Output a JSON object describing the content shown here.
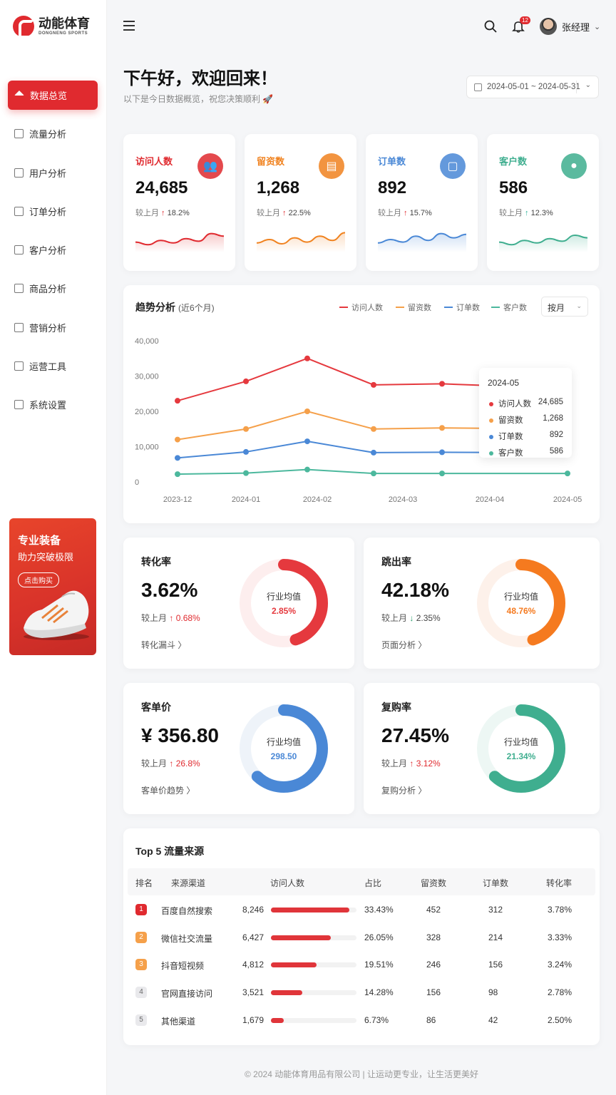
{
  "brand": {
    "name_cn": "动能体育",
    "name_en": "DONGNENG SPORTS"
  },
  "sidebar": {
    "items": [
      {
        "label": "数据总览",
        "active": true
      },
      {
        "label": "流量分析"
      },
      {
        "label": "用户分析"
      },
      {
        "label": "订单分析"
      },
      {
        "label": "客户分析"
      },
      {
        "label": "商品分析"
      },
      {
        "label": "营销分析"
      },
      {
        "label": "运营工具"
      },
      {
        "label": "系统设置"
      }
    ],
    "promo": {
      "title": "专业装备",
      "subtitle": "助力突破极限",
      "button": "点击购买"
    }
  },
  "header": {
    "notifications": "12",
    "user": "张经理"
  },
  "welcome": {
    "title": "下午好，欢迎回来！",
    "subtitle": "以下是今日数据概览，祝您决策顺利 🚀"
  },
  "date_range": "2024-05-01 ~ 2024-05-31",
  "colors": {
    "accent": "#e02a2f",
    "visitors": "#e5393e",
    "leads": "#f5a04a",
    "orders": "#4a88d6",
    "customers": "#4cb89d"
  },
  "stats": [
    {
      "label": "访问人数",
      "value": "24,685",
      "cmp_label": "较上月",
      "cmp": "18.2%",
      "color": "#e02a2f",
      "icon": "users-icon",
      "trend": [
        0.35,
        0.2,
        0.45,
        0.3,
        0.55,
        0.4,
        0.85,
        0.7
      ]
    },
    {
      "label": "留资数",
      "value": "1,268",
      "cmp_label": "较上月",
      "cmp": "22.5%",
      "color": "#f0821f",
      "icon": "document-icon",
      "trend": [
        0.3,
        0.5,
        0.25,
        0.6,
        0.35,
        0.7,
        0.45,
        0.9
      ]
    },
    {
      "label": "订单数",
      "value": "892",
      "cmp_label": "较上月",
      "cmp": "15.7%",
      "color": "#4a88d6",
      "icon": "clipboard-icon",
      "trend": [
        0.3,
        0.5,
        0.35,
        0.7,
        0.45,
        0.85,
        0.6,
        0.8
      ]
    },
    {
      "label": "客户数",
      "value": "586",
      "cmp_label": "较上月",
      "cmp": "12.3%",
      "color": "#3fae8f",
      "icon": "user-icon",
      "trend": [
        0.35,
        0.2,
        0.45,
        0.3,
        0.55,
        0.4,
        0.75,
        0.6
      ]
    }
  ],
  "trend": {
    "title": "趋势分析",
    "subtitle": "(近6个月)",
    "period": "按月",
    "tooltip_title": "2024-05"
  },
  "chart_data": {
    "type": "line",
    "x": [
      "2023-12",
      "2024-01",
      "2024-02",
      "2024-03",
      "2024-04",
      "2024-05"
    ],
    "ylim": [
      0,
      40000
    ],
    "yticks": [
      "40,000",
      "30,000",
      "20,000",
      "10,000",
      "0"
    ],
    "series": [
      {
        "name": "访问人数",
        "color": "#e5393e",
        "values": [
          23000,
          28500,
          35000,
          27500,
          27800,
          24685
        ]
      },
      {
        "name": "留资数",
        "color": "#f5a04a",
        "values": [
          12000,
          15000,
          20000,
          15000,
          15300,
          1268
        ]
      },
      {
        "name": "订单数",
        "color": "#4a88d6",
        "values": [
          6800,
          8500,
          11500,
          8300,
          8400,
          892
        ]
      },
      {
        "name": "客户数",
        "color": "#4cb89d",
        "values": [
          2200,
          2500,
          3500,
          2400,
          2400,
          586
        ]
      }
    ],
    "tooltip_values": [
      "24,685",
      "1,268",
      "892",
      "586"
    ],
    "legend": "top-right",
    "grid": false
  },
  "metrics": [
    {
      "label": "转化率",
      "value": "3.62%",
      "cmp_label": "较上月",
      "cmp": "0.68%",
      "direction": "up",
      "link": "转化漏斗 〉",
      "avg_label": "行业均值",
      "avg_value": "2.85%",
      "progress": 0.45,
      "color": "#e5393e",
      "track": "#fdeeee"
    },
    {
      "label": "跳出率",
      "value": "42.18%",
      "cmp_label": "较上月",
      "cmp": "2.35%",
      "direction": "down",
      "link": "页面分析 〉",
      "avg_label": "行业均值",
      "avg_value": "48.76%",
      "progress": 0.45,
      "color": "#f57a1f",
      "track": "#fdf1ea"
    },
    {
      "label": "客单价",
      "value": "¥ 356.80",
      "cmp_label": "较上月",
      "cmp": "26.8%",
      "direction": "up",
      "link": "客单价趋势 〉",
      "avg_label": "行业均值",
      "avg_value": "298.50",
      "progress": 0.62,
      "color": "#4a88d6",
      "track": "#eef3f9"
    },
    {
      "label": "复购率",
      "value": "27.45%",
      "cmp_label": "较上月",
      "cmp": "3.12%",
      "direction": "up",
      "link": "复购分析 〉",
      "avg_label": "行业均值",
      "avg_value": "21.34%",
      "progress": 0.62,
      "color": "#3fae8f",
      "track": "#edf7f4"
    }
  ],
  "sources": {
    "title": "Top 5 流量来源",
    "headers": [
      "排名",
      "来源渠道",
      "访问人数",
      "占比",
      "留资数",
      "订单数",
      "转化率"
    ],
    "rows": [
      {
        "rank": "1",
        "channel": "百度自然搜索",
        "visitors": "8,246",
        "share": "33.43%",
        "share_frac": 0.92,
        "leads": "452",
        "orders": "312",
        "rate": "3.78%",
        "rank_color": "#e02a2f"
      },
      {
        "rank": "2",
        "channel": "微信社交流量",
        "visitors": "6,427",
        "share": "26.05%",
        "share_frac": 0.7,
        "leads": "328",
        "orders": "214",
        "rate": "3.33%",
        "rank_color": "#f5a04a"
      },
      {
        "rank": "3",
        "channel": "抖音短视频",
        "visitors": "4,812",
        "share": "19.51%",
        "share_frac": 0.53,
        "leads": "246",
        "orders": "156",
        "rate": "3.24%",
        "rank_color": "#f5a04a"
      },
      {
        "rank": "4",
        "channel": "官网直接访问",
        "visitors": "3,521",
        "share": "14.28%",
        "share_frac": 0.37,
        "leads": "156",
        "orders": "98",
        "rate": "2.78%",
        "rank_color": "#e9e9ec"
      },
      {
        "rank": "5",
        "channel": "其他渠道",
        "visitors": "1,679",
        "share": "6.73%",
        "share_frac": 0.15,
        "leads": "86",
        "orders": "42",
        "rate": "2.50%",
        "rank_color": "#e9e9ec"
      }
    ]
  },
  "footer": "© 2024 动能体育用品有限公司 | 让运动更专业，让生活更美好"
}
